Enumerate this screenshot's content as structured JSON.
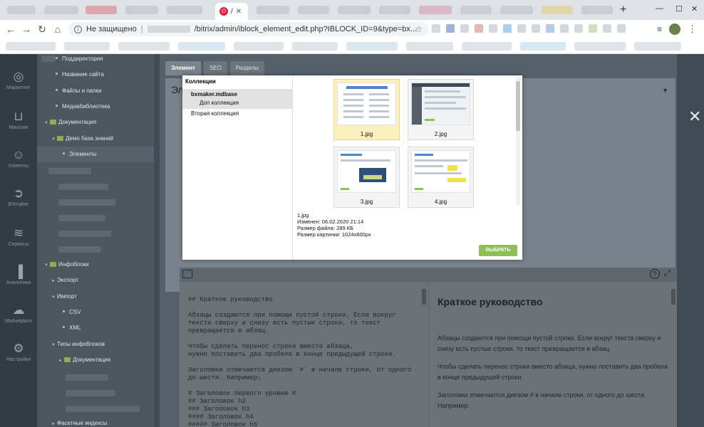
{
  "browser": {
    "tab_title": "/",
    "address": {
      "security_label": "Не защищено",
      "separator": "|",
      "url": "/bitrix/admin/iblock_element_edit.php?IBLOCK_ID=9&type=bx..."
    }
  },
  "leftbar": {
    "items": [
      {
        "label": "Маркетинг",
        "icon": "target-icon"
      },
      {
        "label": "Магазин",
        "icon": "basket-icon"
      },
      {
        "label": "Клиенты",
        "icon": "clients-icon"
      },
      {
        "label": "BXmaker",
        "icon": "arrow-circle-icon"
      },
      {
        "label": "Сервисы",
        "icon": "layers-icon"
      },
      {
        "label": "Аналитика",
        "icon": "bar-chart-icon"
      },
      {
        "label": "Marketplace",
        "icon": "cloud-icon"
      },
      {
        "label": "Настройки",
        "icon": "gear-icon"
      }
    ]
  },
  "tree": {
    "items": [
      "Поддиректория",
      "Название сайта",
      "Файлы и папки",
      "Медиабиблиотека",
      "Документация",
      "Демо база знаний",
      "Элементы",
      "Инфоблоки",
      "Экспорт",
      "Импорт",
      "CSV",
      "XML",
      "Типы инфоблоков",
      "Документация",
      "Фасетные индексы"
    ]
  },
  "content": {
    "tabs": [
      "Элемент",
      "SEO",
      "Разделы"
    ],
    "card_title": "Эле"
  },
  "editor": {
    "markdown": "## Краткое руководство\n\nАбзацы создаются при помощи пустой строки. Если вокруг\nтекста сверху и снизу есть пустые строки, то текст\nпревращается в абзац.\n\nЧтобы сделать перенос строки вместо абзаца,\nнужно поставить два пробела в конце предыдущей строки.\n\nЗаголовки отмечаются диезом `#` в начале строки, от одного\nдо шести. Например:\n\n# Заголовок первого уровня #\n## Заголовок h2\n### Заголовок h3\n#### Заголовок h4\n##### Заголовок h5\n###### Заголовок h6",
    "preview": {
      "heading": "Краткое руководство",
      "p1": "Абзацы создаются при помощи пустой строки. Если вокруг текста сверху и снизу есть пустые строки, то текст превращается в абзац.",
      "p2": "Чтобы сделать перенос строки вместо абзаца, нужно поставить два пробела в конце предыдущей строки.",
      "p3": "Заголовки отмечаются диезом # в начале строки, от одного до шести. Например:"
    },
    "help_icon": "?"
  },
  "modal": {
    "collections_title": "Коллекции",
    "collections": [
      {
        "label": "bxmaker.mdbase"
      },
      {
        "label": "Доп коллекция"
      },
      {
        "label": "Вторая коллекция"
      }
    ],
    "images": [
      {
        "name": "1.jpg",
        "selected": true
      },
      {
        "name": "2.jpg",
        "selected": false
      },
      {
        "name": "3.jpg",
        "selected": false
      },
      {
        "name": "4.jpg",
        "selected": false
      }
    ],
    "info": {
      "name": "1.jpg",
      "modified": "Изменен: 06.02.2020 21:14",
      "file_size": "Размер файла: 289 КБ",
      "image_size": "Размер картинки: 1024x600px"
    },
    "select_button": "ВЫБРАТЬ"
  },
  "colors": {
    "select_button": "#8cc152",
    "selected_thumb": "#fbefbe",
    "sidebar": "#313c43"
  }
}
